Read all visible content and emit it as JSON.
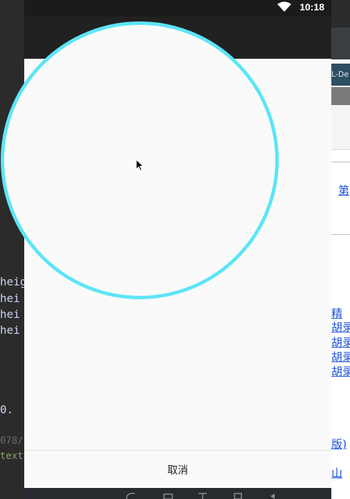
{
  "status_bar": {
    "time": "10:18",
    "icons": [
      "wifi-icon"
    ]
  },
  "ide_background": {
    "code_lines": [
      "heig",
      "hei",
      "hei",
      "hei",
      "0.",
      "078/",
      "text"
    ]
  },
  "browser_background": {
    "tab_label": "L-De",
    "links": [
      "第",
      "精",
      "胡录",
      "胡录",
      "胡录",
      "胡录",
      "版)",
      "山"
    ]
  },
  "dialog": {
    "cancel_label": "取消"
  },
  "navigation_bar": {
    "icons": [
      "back-icon",
      "home-icon",
      "recents-icon",
      "volume-icon"
    ]
  },
  "colors": {
    "circle_stroke": "#5ce5f6",
    "dialog_background": "#fafafa",
    "status_bar": "#1b1b1b",
    "action_bar": "#212121"
  }
}
